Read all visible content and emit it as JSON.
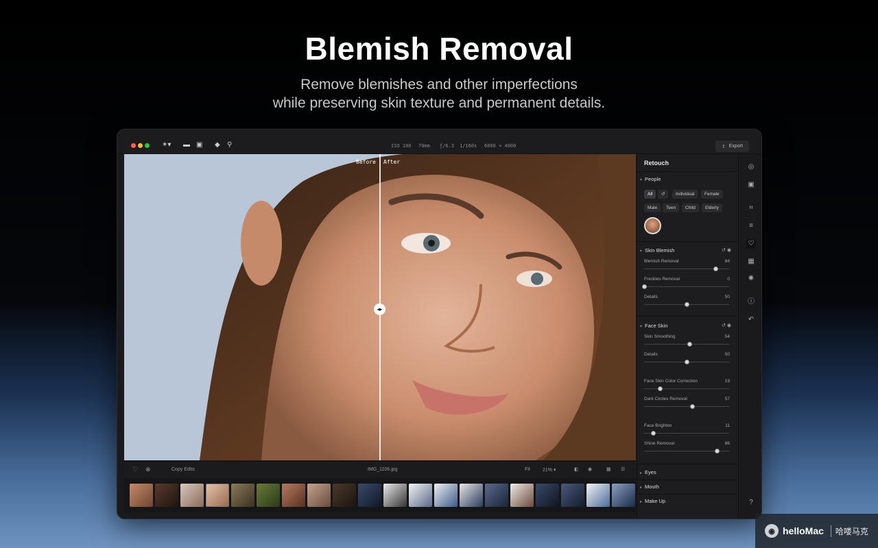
{
  "hero": {
    "title": "Blemish Removal",
    "subtitle_line1": "Remove blemishes and other imperfections",
    "subtitle_line2": "while preserving skin texture and permanent details."
  },
  "titlebar": {
    "icons": [
      "close-dot",
      "minimize-dot",
      "zoom-dot",
      "magic-wand-icon",
      "folder-icon",
      "gallery-icon",
      "eraser-icon",
      "zoom-icon"
    ],
    "meta": [
      "ISO 100",
      "70mm",
      "ƒ/6.3",
      "1/160s",
      "6000 × 4000"
    ],
    "export_label": "Export"
  },
  "canvas": {
    "before_label": "Before",
    "after_label": "After",
    "split_handle_glyph": "◂▸"
  },
  "bottombar": {
    "copy_edits": "Copy Edits",
    "filename": "IMG_1106.jpg",
    "fit_label": "Fit",
    "zoom_label": "21% ▾"
  },
  "panel": {
    "title": "Retouch",
    "people": {
      "label": "People",
      "chips_row1": [
        "All",
        "↺",
        "Individual",
        "Female"
      ],
      "chips_row2": [
        "Male",
        "Teen",
        "Child",
        "Elderly"
      ]
    },
    "skin_blemish": {
      "label": "Skin Blemish",
      "sliders": [
        {
          "label": "Blemish Removal",
          "value": 84
        },
        {
          "label": "Freckles Removal",
          "value": 0
        },
        {
          "label": "Details",
          "value": 50
        }
      ]
    },
    "face_skin": {
      "label": "Face Skin",
      "sliders": [
        {
          "label": "Skin Smoothing",
          "value": 54
        },
        {
          "label": "Details",
          "value": 50
        },
        {
          "label": "Face Skin Color Correction",
          "value": 19
        },
        {
          "label": "Dark Circles Removal",
          "value": 57
        },
        {
          "label": "Face Brighten",
          "value": 11
        },
        {
          "label": "Shine Removal",
          "value": 86
        }
      ]
    },
    "collapsed_sections": [
      "Eyes",
      "Mouth",
      "Make Up"
    ]
  },
  "brand": {
    "logo_glyph": "◉",
    "name": "helloMac",
    "sub": "哈喽马克"
  }
}
